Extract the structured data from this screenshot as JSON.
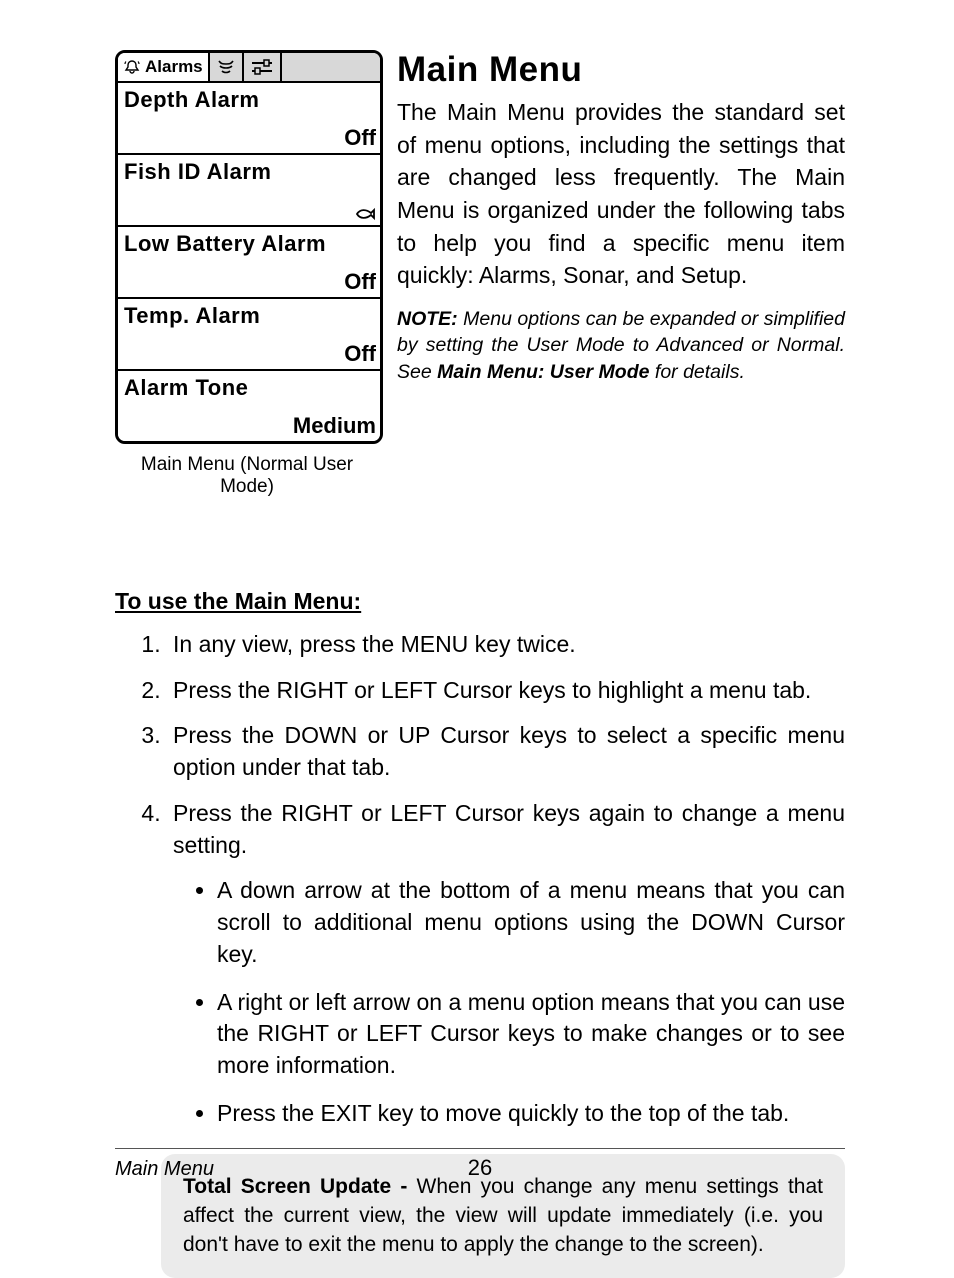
{
  "device": {
    "tabs": {
      "alarms_label": "Alarms"
    },
    "rows": [
      {
        "label": "Depth Alarm",
        "value": "Off",
        "value_type": "text"
      },
      {
        "label": "Fish ID Alarm",
        "value": "",
        "value_type": "fish-icon"
      },
      {
        "label": "Low Battery Alarm",
        "value": "Off",
        "value_type": "text"
      },
      {
        "label": "Temp. Alarm",
        "value": "Off",
        "value_type": "text"
      },
      {
        "label": "Alarm Tone",
        "value": "Medium",
        "value_type": "text"
      }
    ],
    "caption": "Main Menu (Normal User Mode)"
  },
  "title": "Main Menu",
  "intro": "The Main Menu provides the standard set of menu options, including the settings that are changed less frequently. The Main Menu is organized under the following tabs to help you find a specific menu item quickly: Alarms, Sonar, and Setup.",
  "note": {
    "label": "NOTE:",
    "body": " Menu options can be expanded or simplified by setting the User Mode to Advanced or Normal. See ",
    "ref": "Main Menu: User Mode",
    "tail": " for details."
  },
  "subheading": "To use the Main Menu:",
  "steps": [
    "In any view, press the MENU key twice.",
    "Press the RIGHT or LEFT Cursor keys to highlight a menu tab.",
    "Press the DOWN or UP Cursor keys to select a specific menu option under that tab.",
    "Press the RIGHT or LEFT Cursor keys again to change a menu setting."
  ],
  "bullets": [
    "A down arrow at the bottom of a menu means that you can scroll to additional menu options using the DOWN Cursor key.",
    "A right or left arrow on a menu option means that you can use the RIGHT or LEFT Cursor keys to make changes or to see more information.",
    "Press the EXIT key to move quickly to the top of the tab."
  ],
  "callout": {
    "label": "Total Screen Update - ",
    "body": "When you change any menu settings that affect the current view, the view will update immediately (i.e. you don't have to exit the menu to apply the change to the screen)."
  },
  "footer": {
    "section": "Main Menu",
    "page": "26"
  }
}
